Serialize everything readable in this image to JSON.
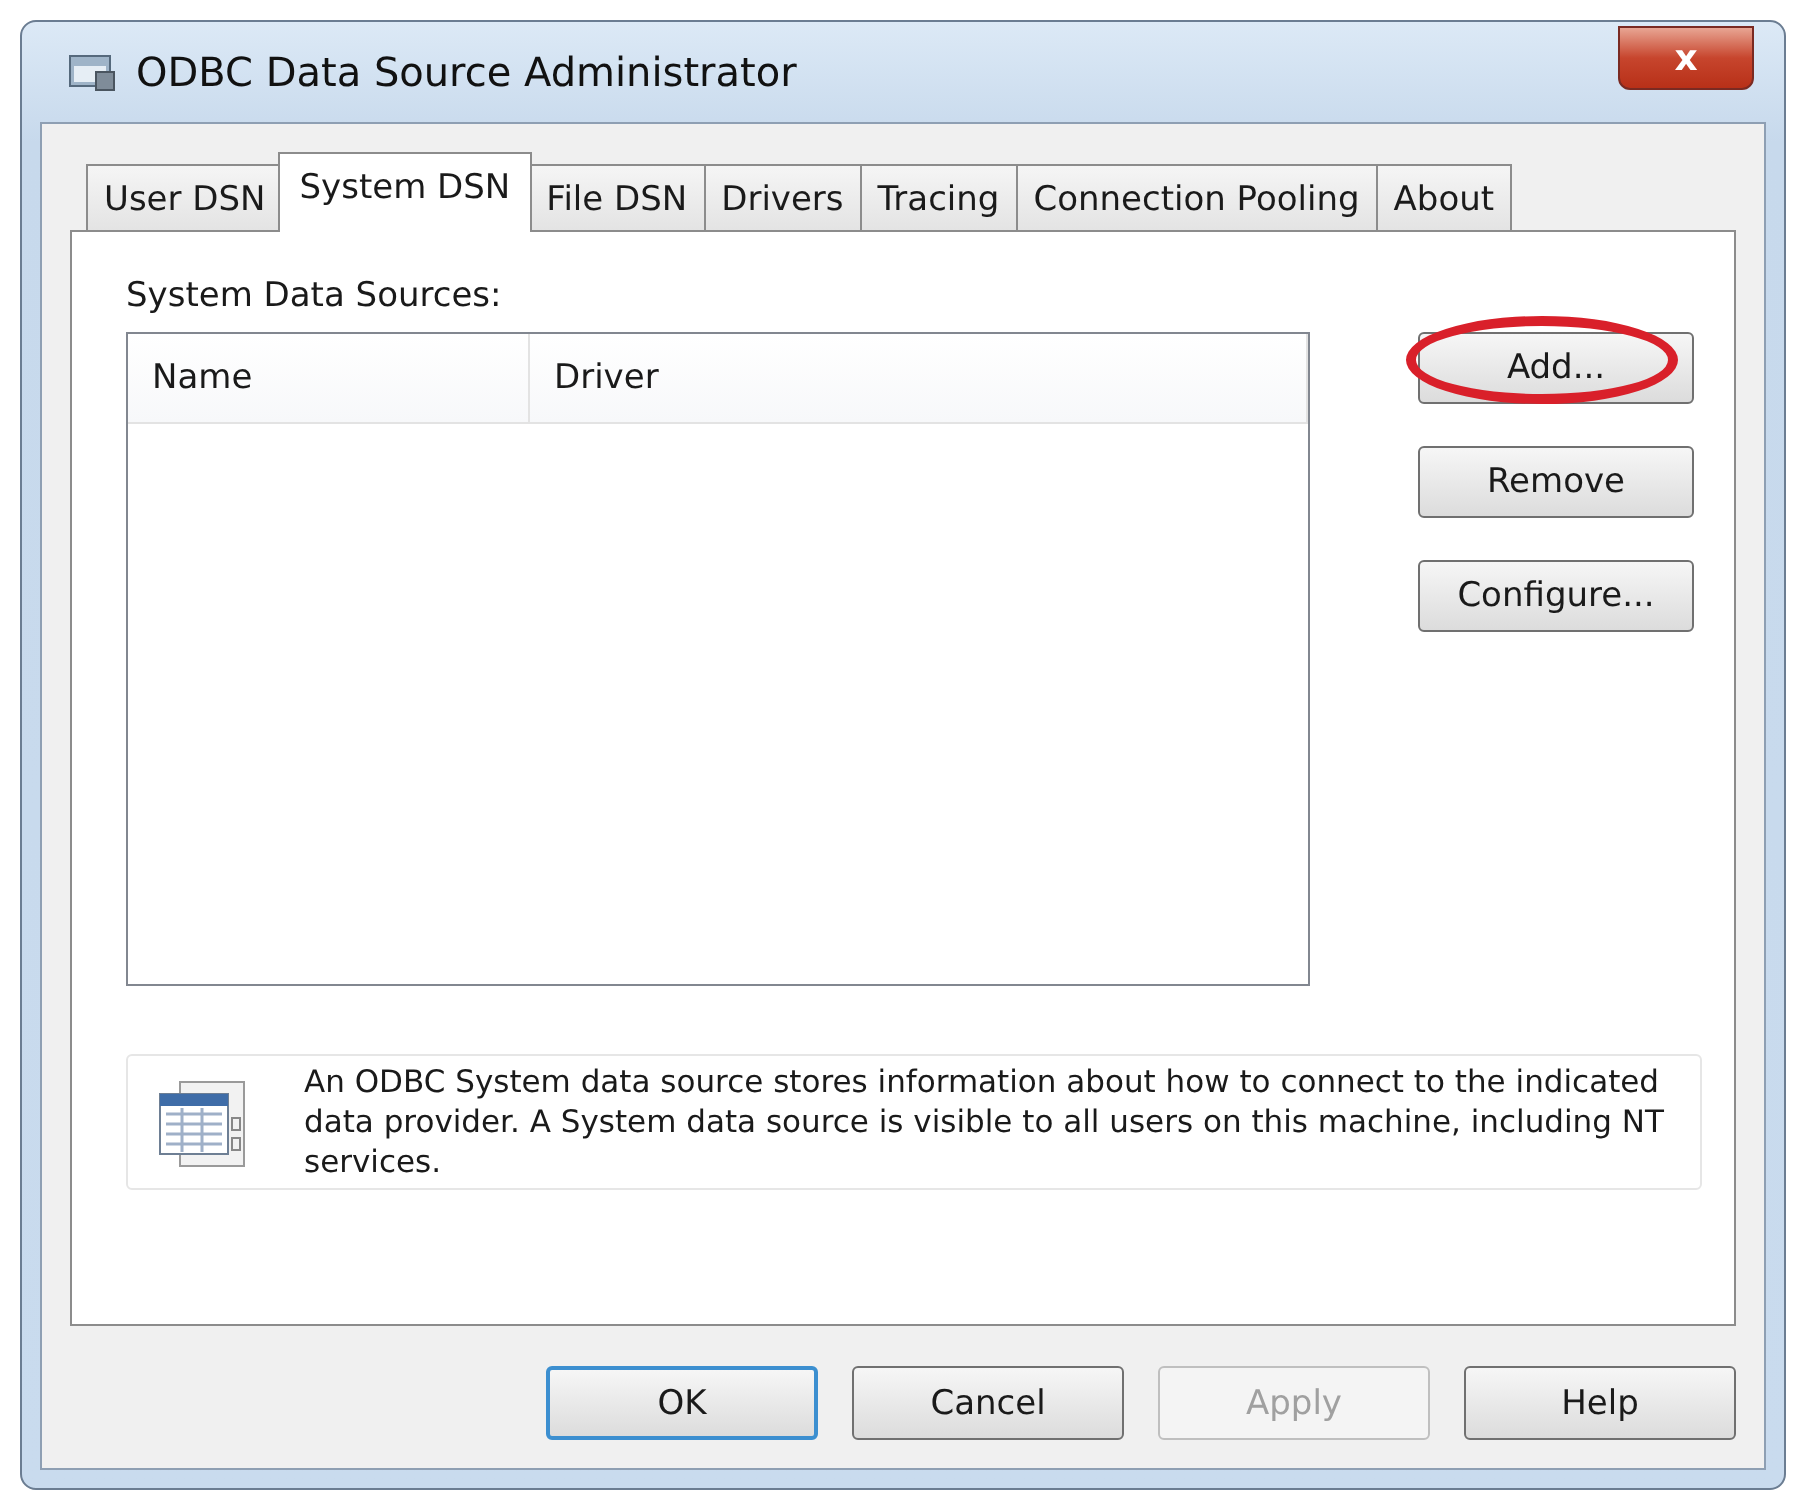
{
  "window": {
    "title": "ODBC Data Source Administrator",
    "close_label": "x"
  },
  "tabs": [
    {
      "label": "User DSN",
      "selected": false
    },
    {
      "label": "System DSN",
      "selected": true
    },
    {
      "label": "File DSN",
      "selected": false
    },
    {
      "label": "Drivers",
      "selected": false
    },
    {
      "label": "Tracing",
      "selected": false
    },
    {
      "label": "Connection Pooling",
      "selected": false
    },
    {
      "label": "About",
      "selected": false
    }
  ],
  "list_label": "System Data Sources:",
  "table": {
    "columns": [
      "Name",
      "Driver"
    ]
  },
  "side_buttons": [
    {
      "label": "Add...",
      "highlighted": true
    },
    {
      "label": "Remove",
      "highlighted": false
    },
    {
      "label": "Configure...",
      "highlighted": false
    }
  ],
  "info": "An ODBC System data source stores information about how to connect to the indicated data provider.   A System data source is visible to all users on this machine, including NT services.",
  "buttons": [
    {
      "label": "OK",
      "default": true,
      "disabled": false
    },
    {
      "label": "Cancel",
      "default": false,
      "disabled": false
    },
    {
      "label": "Apply",
      "default": false,
      "disabled": true
    },
    {
      "label": "Help",
      "default": false,
      "disabled": false
    }
  ]
}
